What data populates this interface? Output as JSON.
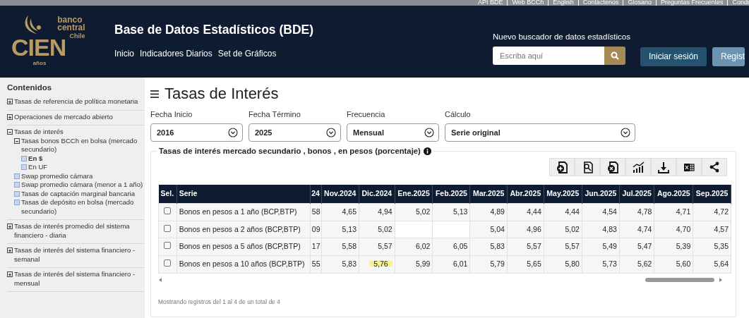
{
  "top_links": [
    "API BDE",
    "Web BCCh",
    "English",
    "Contáctenos",
    "Glosario",
    "Preguntas Frecuentes",
    "Condi"
  ],
  "logo": {
    "line_1": "banco",
    "line_2": "central",
    "line_3": "Chile",
    "mark": "CIEN",
    "sub": "años"
  },
  "header": {
    "title": "Base de Datos Estadísticos (BDE)",
    "nav": [
      "Inicio",
      "Indicadores Diarios",
      "Set de Gráficos"
    ]
  },
  "search": {
    "label": "Nuevo buscador de datos estadísticos",
    "placeholder": "Escriba aquí"
  },
  "account_buttons": [
    {
      "label": "Iniciar sesión",
      "kind": "primary"
    },
    {
      "label": "Regist",
      "kind": "secondary"
    }
  ],
  "sidebar": {
    "title": "Contenidos",
    "items": [
      {
        "label": "Tasas de referencia de política monetaria",
        "kind": "group",
        "expanded": false
      },
      {
        "label": "Operaciones de mercado abierto",
        "kind": "group",
        "expanded": false
      },
      {
        "label": "Tasas de interés",
        "kind": "group",
        "expanded": true,
        "children": [
          {
            "label": "Tasas bonos BCCh en bolsa (mercado secundario)",
            "kind": "group",
            "expanded": true,
            "children": [
              {
                "label": "En $",
                "kind": "item",
                "selected": true
              },
              {
                "label": "En UF",
                "kind": "item",
                "selected": false
              }
            ]
          },
          {
            "label": "Swap promedio cámara",
            "kind": "item",
            "selected": false
          },
          {
            "label": "Swap promedio cámara (menor a 1 año)",
            "kind": "item",
            "selected": false
          },
          {
            "label": "Tasas de captación marginal bancaria",
            "kind": "item",
            "selected": false
          },
          {
            "label": "Tasas de depósito en bolsa (mercado secundario)",
            "kind": "item",
            "selected": false
          }
        ]
      },
      {
        "label": "Tasas de interés promedio del sistema financiero - diaria",
        "kind": "group",
        "expanded": false
      },
      {
        "label": "Tasas de interés del sistema financiero - semanal",
        "kind": "group",
        "expanded": false
      },
      {
        "label": "Tasas de interés del sistema financiero - mensual",
        "kind": "group",
        "expanded": false
      }
    ]
  },
  "page_title": "Tasas de Interés",
  "filters": [
    {
      "label": "Fecha Inicio",
      "value": "2016"
    },
    {
      "label": "Fecha Término",
      "value": "2025"
    },
    {
      "label": "Frecuencia",
      "value": "Mensual"
    },
    {
      "label": "Cálculo",
      "value": "Serie original"
    }
  ],
  "panel": {
    "title": "Tasas de interés mercado secundario , bonos , en pesos (porcentaje)",
    "footer": "Mostrando registros del 1 al 4 de un total de 4"
  },
  "toolbar": [
    {
      "kind": "add-file"
    },
    {
      "kind": "search-file"
    },
    {
      "kind": "remove-file"
    },
    {
      "kind": "chart"
    },
    {
      "kind": "download"
    },
    {
      "kind": "excel"
    },
    {
      "kind": "share"
    }
  ],
  "table": {
    "columns": [
      "Sel.",
      "Serie",
      "24",
      "Nov.2024",
      "Dic.2024",
      "Ene.2025",
      "Feb.2025",
      "Mar.2025",
      "Abr.2025",
      "May.2025",
      "Jun.2025",
      "Jul.2025",
      "Ago.2025",
      "Sep.2025"
    ],
    "rows": [
      {
        "checked": false,
        "serie": "Bonos en pesos a 1 año (BCP,BTP)",
        "values": [
          {
            "text": "58"
          },
          {
            "text": "4,65"
          },
          {
            "text": "4,94"
          },
          {
            "text": "5,02"
          },
          {
            "text": "5,13"
          },
          {
            "text": "4,89"
          },
          {
            "text": "4,44"
          },
          {
            "text": "4,44"
          },
          {
            "text": "4,54"
          },
          {
            "text": "4,78"
          },
          {
            "text": "4,71"
          },
          {
            "text": "4,72"
          }
        ]
      },
      {
        "checked": false,
        "serie": "Bonos en pesos a 2 años (BCP,BTP)",
        "values": [
          {
            "text": "09"
          },
          {
            "text": "5,13"
          },
          {
            "text": "5,02"
          },
          {
            "kind": "blank"
          },
          {
            "kind": "blank"
          },
          {
            "text": "5,04"
          },
          {
            "text": "4,96"
          },
          {
            "text": "5,02"
          },
          {
            "text": "4,83"
          },
          {
            "text": "4,74"
          },
          {
            "text": "4,70"
          },
          {
            "text": "4,57"
          }
        ]
      },
      {
        "checked": false,
        "serie": "Bonos en pesos a 5 años (BCP,BTP)",
        "values": [
          {
            "text": "17"
          },
          {
            "text": "5,58"
          },
          {
            "text": "5,57"
          },
          {
            "text": "6,02"
          },
          {
            "text": "6,05"
          },
          {
            "text": "5,83"
          },
          {
            "text": "5,57"
          },
          {
            "text": "5,57"
          },
          {
            "text": "5,49"
          },
          {
            "text": "5,47"
          },
          {
            "text": "5,39"
          },
          {
            "text": "5,35"
          }
        ]
      },
      {
        "checked": false,
        "serie": "Bonos en pesos a 10 años (BCP,BTP)",
        "values": [
          {
            "text": "55"
          },
          {
            "text": "5,83"
          },
          {
            "text": "5,76",
            "highlighted": true
          },
          {
            "text": "5,99"
          },
          {
            "text": "6,01"
          },
          {
            "text": "5,79"
          },
          {
            "text": "5,65"
          },
          {
            "text": "5,80"
          },
          {
            "text": "5,73"
          },
          {
            "text": "5,62"
          },
          {
            "text": "5,60"
          },
          {
            "text": "5,64"
          }
        ]
      }
    ]
  }
}
